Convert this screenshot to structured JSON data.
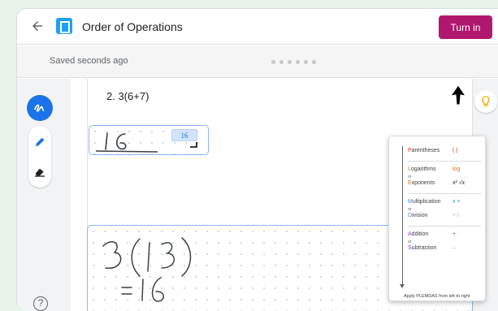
{
  "header": {
    "title": "Order of Operations",
    "turn_in_label": "Turn in"
  },
  "status": {
    "saved_text": "Saved seconds ago",
    "page_count": 6
  },
  "problem": {
    "text": "2. 3(6+7)",
    "answer_handwritten": "16",
    "answer_badge": "16"
  },
  "work": {
    "line1": "3(13)",
    "line2": "=16"
  },
  "tools": {
    "draw": "draw-tool-icon",
    "pen": "pen-icon",
    "eraser": "eraser-icon",
    "help": "?"
  },
  "hint": {
    "icon": "lightbulb-icon",
    "rows": [
      {
        "first": "P",
        "rest": "arentheses",
        "symbol": "( )",
        "color": "#d93025"
      },
      {
        "first": "L",
        "rest": "ogarithms",
        "symbol": "log",
        "color": "#e8710a"
      },
      {
        "first": "E",
        "rest": "xponents",
        "symbol": "x² √x",
        "color": "#202124"
      },
      {
        "first": "M",
        "rest": "ultiplication",
        "symbol": "x  ×",
        "color": "#4285f4"
      },
      {
        "first": "D",
        "rest": "ivision",
        "symbol": "÷  /",
        "color": "#9aa0a6"
      },
      {
        "first": "A",
        "rest": "ddition",
        "symbol": "+",
        "color": "#9334e6"
      },
      {
        "first": "S",
        "rest": "ubtraction",
        "symbol": "–",
        "color": "#9aa0a6"
      }
    ],
    "or_label": "or",
    "footer": "Apply PLEMDAS from left to right"
  },
  "colors": {
    "accent": "#1a73e8",
    "turn_in": "#b0186d",
    "background": "#e6f4ea",
    "hint_bulb": "#f9ab00"
  }
}
